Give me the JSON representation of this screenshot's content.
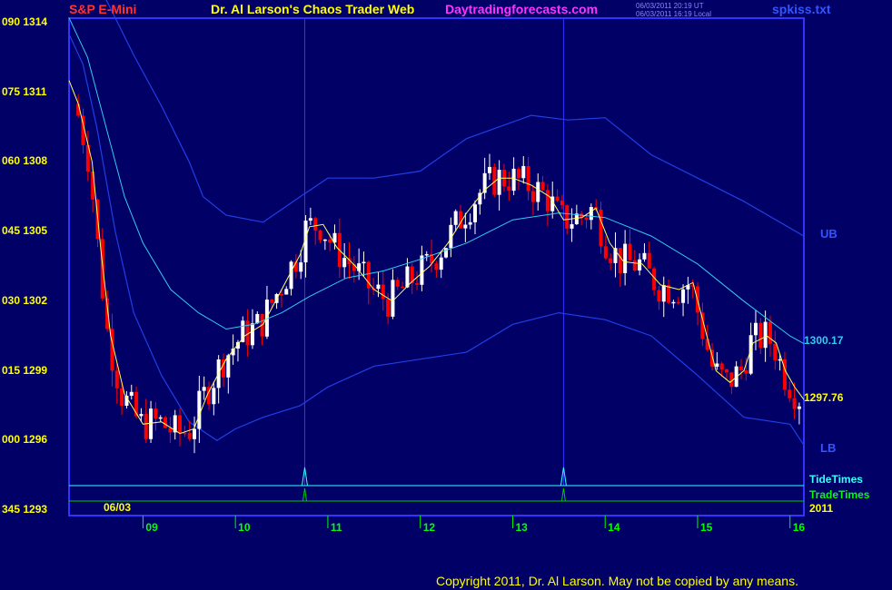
{
  "header": {
    "left_title": "S&P E-Mini",
    "center_title": "Dr. Al Larson's Chaos Trader Web",
    "site": "Daytradingforecasts.com",
    "stamp_line1": "06/03/2011 20:19 UT",
    "stamp_line2": "06/03/2011 16:19 Local",
    "file_name": "spkiss.txt"
  },
  "footer": {
    "copyright": "Copyright 2011, Dr. Al Larson. May not be copied by any means."
  },
  "colors": {
    "background": "#000066",
    "frame": "#3333ff",
    "bands": "#1f3fe6",
    "mid_ema": "#33ccee",
    "fast_ema": "#ffff66",
    "up_candle": "#ffffff",
    "down_candle": "#ff0000",
    "tide_times": "#33ffff",
    "trade_times": "#00cc00",
    "date_text": "#ffff00"
  },
  "chart_data": {
    "type": "candlestick",
    "title": "S&P E-Mini",
    "x_ticks": [
      "09",
      "10",
      "11",
      "12",
      "13",
      "14",
      "15",
      "16"
    ],
    "x_range": [
      8.2,
      16.15
    ],
    "y_labels": [
      {
        "time": "090",
        "price": 1314
      },
      {
        "time": "075",
        "price": 1311
      },
      {
        "time": "060",
        "price": 1308
      },
      {
        "time": "045",
        "price": 1305
      },
      {
        "time": "030",
        "price": 1302
      },
      {
        "time": "015",
        "price": 1299
      },
      {
        "time": "000",
        "price": 1296
      },
      {
        "time": "345",
        "price": 1293
      }
    ],
    "y_range": [
      1293,
      1314.5
    ],
    "date_label": "06/03",
    "year_label": "2011",
    "tide_times_label": "TideTimes",
    "trade_times_label": "TradeTimes",
    "band_labels": {
      "upper": "UB",
      "lower": "LB"
    },
    "last_mid_value": "1300.17",
    "last_close_value": "1297.76",
    "vertical_markers": [
      10.75,
      13.55
    ],
    "series": [
      {
        "kind": "upper_band",
        "points": [
          [
            9.65,
            1306.5
          ],
          [
            9.9,
            1305.7
          ],
          [
            10.3,
            1305.4
          ],
          [
            10.7,
            1306.5
          ],
          [
            11.0,
            1307.3
          ],
          [
            11.5,
            1307.3
          ],
          [
            12.0,
            1307.6
          ],
          [
            12.5,
            1309.0
          ],
          [
            13.2,
            1310.0
          ],
          [
            13.6,
            1309.8
          ],
          [
            14.0,
            1309.9
          ],
          [
            14.5,
            1308.3
          ],
          [
            15.0,
            1307.3
          ],
          [
            15.5,
            1306.3
          ],
          [
            16.15,
            1304.8
          ]
        ]
      },
      {
        "kind": "upper_band_early",
        "points": [
          [
            8.6,
            1315.0
          ],
          [
            8.9,
            1312.6
          ],
          [
            9.2,
            1310.4
          ],
          [
            9.5,
            1308.0
          ],
          [
            9.65,
            1306.5
          ]
        ]
      },
      {
        "kind": "lower_band",
        "points": [
          [
            8.2,
            1313.5
          ],
          [
            8.35,
            1312.2
          ],
          [
            8.5,
            1309.5
          ],
          [
            8.7,
            1305.0
          ],
          [
            8.9,
            1301.5
          ],
          [
            9.2,
            1298.8
          ],
          [
            9.5,
            1296.8
          ],
          [
            9.8,
            1296.0
          ],
          [
            10.0,
            1296.5
          ],
          [
            10.3,
            1297.0
          ],
          [
            10.7,
            1297.5
          ],
          [
            11.0,
            1298.3
          ],
          [
            11.5,
            1299.2
          ],
          [
            12.0,
            1299.5
          ],
          [
            12.5,
            1299.8
          ],
          [
            13.0,
            1301.0
          ],
          [
            13.5,
            1301.5
          ],
          [
            14.0,
            1301.2
          ],
          [
            14.5,
            1300.5
          ],
          [
            15.0,
            1298.8
          ],
          [
            15.5,
            1297.0
          ],
          [
            16.0,
            1296.7
          ],
          [
            16.15,
            1295.8
          ]
        ]
      },
      {
        "kind": "mid_ema",
        "points": [
          [
            8.2,
            1314.2
          ],
          [
            8.4,
            1312.5
          ],
          [
            8.6,
            1309.5
          ],
          [
            8.8,
            1306.5
          ],
          [
            9.0,
            1304.5
          ],
          [
            9.3,
            1302.5
          ],
          [
            9.6,
            1301.5
          ],
          [
            9.9,
            1300.8
          ],
          [
            10.2,
            1301.0
          ],
          [
            10.5,
            1301.5
          ],
          [
            10.8,
            1302.2
          ],
          [
            11.2,
            1303.0
          ],
          [
            11.6,
            1303.3
          ],
          [
            12.0,
            1303.8
          ],
          [
            12.5,
            1304.5
          ],
          [
            13.0,
            1305.5
          ],
          [
            13.5,
            1305.8
          ],
          [
            14.0,
            1305.6
          ],
          [
            14.5,
            1304.8
          ],
          [
            15.0,
            1303.6
          ],
          [
            15.5,
            1302.0
          ],
          [
            16.0,
            1300.5
          ],
          [
            16.15,
            1300.17
          ]
        ]
      },
      {
        "kind": "fast_ema",
        "points": [
          [
            8.2,
            1311.5
          ],
          [
            8.3,
            1310.5
          ],
          [
            8.45,
            1308.0
          ],
          [
            8.55,
            1304.0
          ],
          [
            8.65,
            1300.5
          ],
          [
            8.8,
            1298.0
          ],
          [
            9.0,
            1296.7
          ],
          [
            9.2,
            1296.8
          ],
          [
            9.4,
            1296.3
          ],
          [
            9.55,
            1296.5
          ],
          [
            9.7,
            1298.0
          ],
          [
            9.9,
            1299.5
          ],
          [
            10.1,
            1300.5
          ],
          [
            10.3,
            1301.0
          ],
          [
            10.5,
            1302.5
          ],
          [
            10.7,
            1304.0
          ],
          [
            10.8,
            1305.2
          ],
          [
            10.95,
            1305.3
          ],
          [
            11.1,
            1304.3
          ],
          [
            11.3,
            1303.5
          ],
          [
            11.5,
            1302.5
          ],
          [
            11.7,
            1302.0
          ],
          [
            11.9,
            1302.8
          ],
          [
            12.1,
            1303.5
          ],
          [
            12.3,
            1304.5
          ],
          [
            12.5,
            1305.8
          ],
          [
            12.7,
            1306.8
          ],
          [
            12.85,
            1307.3
          ],
          [
            13.0,
            1307.3
          ],
          [
            13.2,
            1307.0
          ],
          [
            13.4,
            1306.5
          ],
          [
            13.55,
            1305.5
          ],
          [
            13.75,
            1305.6
          ],
          [
            13.9,
            1306.0
          ],
          [
            14.05,
            1304.5
          ],
          [
            14.2,
            1303.7
          ],
          [
            14.4,
            1303.6
          ],
          [
            14.6,
            1302.7
          ],
          [
            14.8,
            1302.5
          ],
          [
            14.95,
            1302.8
          ],
          [
            15.1,
            1300.5
          ],
          [
            15.2,
            1299.0
          ],
          [
            15.35,
            1298.5
          ],
          [
            15.5,
            1299.0
          ],
          [
            15.6,
            1300.2
          ],
          [
            15.75,
            1300.5
          ],
          [
            15.85,
            1300.2
          ],
          [
            15.95,
            1299.0
          ],
          [
            16.05,
            1298.3
          ],
          [
            16.15,
            1297.76
          ]
        ]
      }
    ]
  }
}
